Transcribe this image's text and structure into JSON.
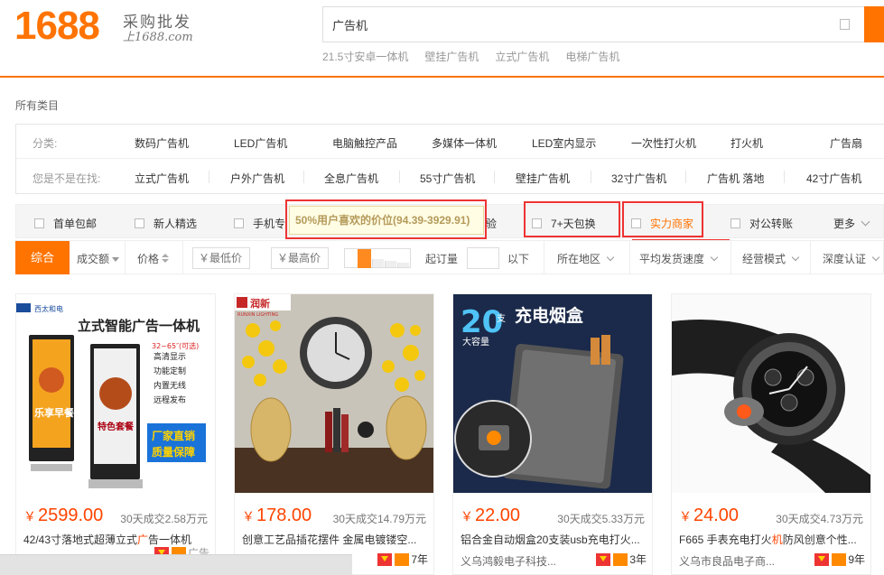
{
  "logo": {
    "number": "1688",
    "tagline": "采购批发",
    "url": "上1688.com"
  },
  "search": {
    "value": "广告机",
    "hot_words": [
      "21.5寸安卓一体机",
      "壁挂广告机",
      "立式广告机",
      "电梯广告机"
    ]
  },
  "categories": {
    "all_label": "所有类目",
    "row1_label": "分类:",
    "row1_items": [
      "数码广告机",
      "LED广告机",
      "电脑触控产品",
      "多媒体一体机",
      "LED室内显示",
      "一次性打火机",
      "打火机",
      "广告扇"
    ],
    "row2_label": "您是不是在找:",
    "row2_items": [
      "立式广告机",
      "户外广告机",
      "全息广告机",
      "55寸广告机",
      "壁挂广告机",
      "32寸广告机",
      "广告机 落地",
      "42寸广告机"
    ]
  },
  "filters": {
    "checkboxes": [
      "首单包邮",
      "新人精选",
      "手机专",
      "验",
      "7+天包换",
      "实力商家",
      "对公转账"
    ],
    "more_label": "更多",
    "tooltip": "50%用户喜欢的价位(94.39-3929.91)"
  },
  "sort": {
    "active": "综合",
    "volume": "成交额",
    "price": "价格",
    "min_price_placeholder": "￥最低价",
    "max_price_placeholder": "￥最高价",
    "dash": "–",
    "moq_label": "起订量",
    "moq_suffix": "以下",
    "region": "所在地区",
    "shipping": "平均发货速度",
    "business_mode": "经营模式",
    "certification": "深度认证"
  },
  "products": [
    {
      "price": "2599.00",
      "currency": "￥",
      "sold": "30天成交2.58万元",
      "title_prefix": "42/43寸落地式超薄立式",
      "title_hl": "广",
      "title_suffix": "告一体机",
      "seller": "",
      "years": "",
      "badge_extra": "广告",
      "img_text": {
        "brand": "西太和电",
        "headline": "立式智能广告一体机",
        "sizes": "32~65″(可选)",
        "features": [
          "高清显示",
          "功能定制",
          "内置无线",
          "远程发布"
        ],
        "promo1": "乐享早餐",
        "promo2": "特色套餐",
        "slogan1": "厂家直销",
        "slogan2": "质量保障"
      }
    },
    {
      "price": "178.00",
      "currency": "￥",
      "sold": "30天成交14.79万元",
      "title_prefix": "创意工艺品插花摆件 金属电镀镂空...",
      "title_hl": "",
      "title_suffix": "",
      "seller": "",
      "years": "7年",
      "img_text": {
        "brand": "润新",
        "brand_en": "RUNXIN LIGHTING"
      }
    },
    {
      "price": "22.00",
      "currency": "￥",
      "sold": "30天成交5.33万元",
      "title_prefix": "铝合金自动烟盒20支装usb充电打火...",
      "title_hl": "",
      "title_suffix": "",
      "seller": "义乌鸿毅电子科技...",
      "years": "3年",
      "img_text": {
        "big": "20",
        "unit": "支",
        "cap": "大容量",
        "headline": "充电烟盒"
      }
    },
    {
      "price": "24.00",
      "currency": "￥",
      "sold": "30天成交4.73万元",
      "title_prefix": "F665 手表充电打火",
      "title_hl": "机",
      "title_suffix": "防风创意个性...",
      "seller": "义乌市良品电子商...",
      "years": "9年",
      "img_text": {}
    }
  ],
  "colors": {
    "brand": "#ff7300",
    "price": "#ff4400",
    "highlight_box": "#e33333"
  }
}
